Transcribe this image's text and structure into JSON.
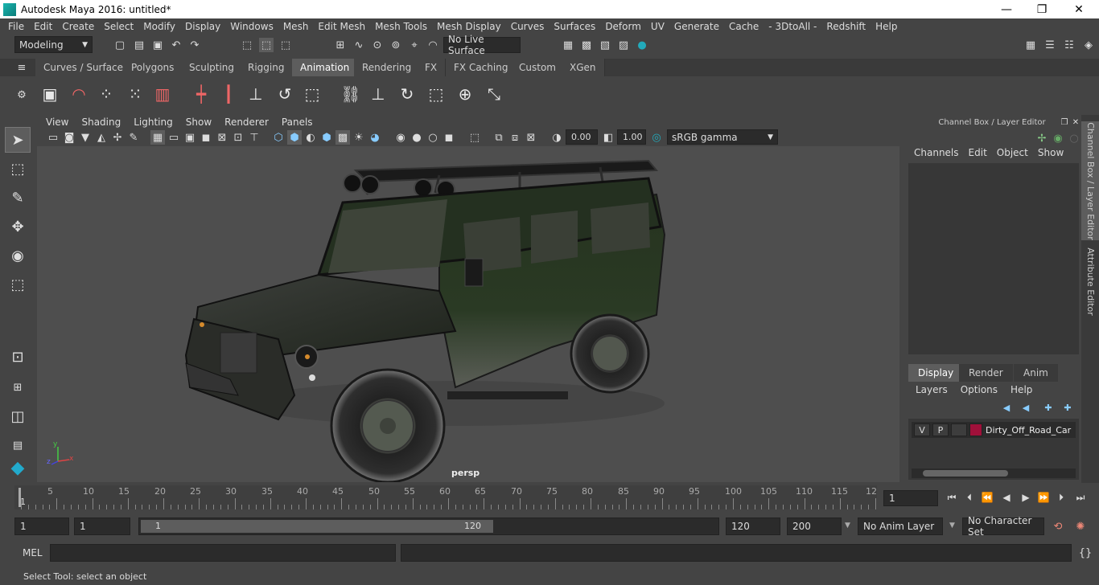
{
  "window": {
    "title": "Autodesk Maya 2016: untitled*",
    "controls": [
      "—",
      "❐",
      "✕"
    ]
  },
  "menubar": [
    "File",
    "Edit",
    "Create",
    "Select",
    "Modify",
    "Display",
    "Windows",
    "Mesh",
    "Edit Mesh",
    "Mesh Tools",
    "Mesh Display",
    "Curves",
    "Surfaces",
    "Deform",
    "UV",
    "Generate",
    "Cache",
    "- 3DtoAll -",
    "Redshift",
    "Help"
  ],
  "statusline": {
    "mode": "Modeling",
    "live_surface": "No Live Surface"
  },
  "shelf_tabs": [
    "Curves / Surfaces",
    "Polygons",
    "Sculpting",
    "Rigging",
    "Animation",
    "Rendering",
    "FX",
    "FX Caching",
    "Custom",
    "XGen"
  ],
  "shelf_active_tab": "Animation",
  "viewport": {
    "menu": [
      "View",
      "Shading",
      "Lighting",
      "Show",
      "Renderer",
      "Panels"
    ],
    "exposure": "0.00",
    "gamma": "1.00",
    "color_space": "sRGB gamma",
    "camera_label": "persp",
    "axis_x": "x",
    "axis_y": "y",
    "axis_z": "z"
  },
  "channel_box": {
    "header": "Channel Box / Layer Editor",
    "menu": [
      "Channels",
      "Edit",
      "Object",
      "Show"
    ]
  },
  "layer_editor": {
    "tabs": [
      "Display",
      "Render",
      "Anim"
    ],
    "menu": [
      "Layers",
      "Options",
      "Help"
    ],
    "layer": {
      "v": "V",
      "p": "P",
      "name": "Dirty_Off_Road_Car",
      "color": "#a0103a"
    }
  },
  "side_tabs": [
    "Channel Box / Layer Editor",
    "Attribute Editor"
  ],
  "timeline": {
    "ticks": [
      "5",
      "10",
      "15",
      "20",
      "25",
      "30",
      "35",
      "40",
      "45",
      "50",
      "55",
      "60",
      "65",
      "70",
      "75",
      "80",
      "85",
      "90",
      "95",
      "100",
      "105",
      "110",
      "115",
      "12"
    ],
    "current_marker": "1",
    "current_frame": "1"
  },
  "range": {
    "start": "1",
    "playback_start": "1",
    "slider_start": "1",
    "slider_end": "120",
    "playback_end": "120",
    "end": "200",
    "anim_layer": "No Anim Layer",
    "character_set": "No Character Set"
  },
  "command": {
    "label": "MEL"
  },
  "help_line": "Select Tool: select an object"
}
